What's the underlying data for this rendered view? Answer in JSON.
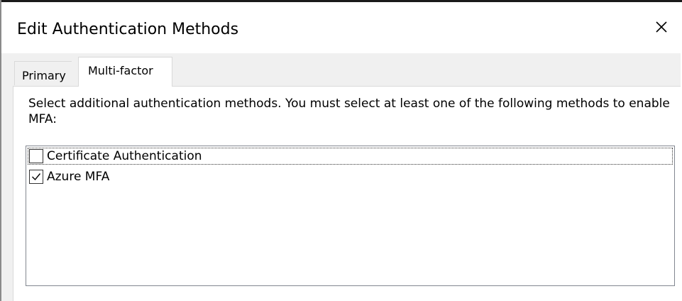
{
  "window": {
    "title": "Edit Authentication Methods",
    "close_icon": "close-icon"
  },
  "tabs": [
    {
      "label": "Primary",
      "selected": false
    },
    {
      "label": "Multi-factor",
      "selected": true
    }
  ],
  "panel": {
    "instructions": "Select additional authentication methods. You must select at least one of the following methods to enable MFA:",
    "methods": [
      {
        "label": "Certificate Authentication",
        "checked": false,
        "focused": true
      },
      {
        "label": "Azure MFA",
        "checked": true,
        "focused": false
      }
    ]
  },
  "colors": {
    "dialog_background": "#f0f0f0",
    "panel_background": "#ffffff",
    "list_border": "#828790"
  }
}
